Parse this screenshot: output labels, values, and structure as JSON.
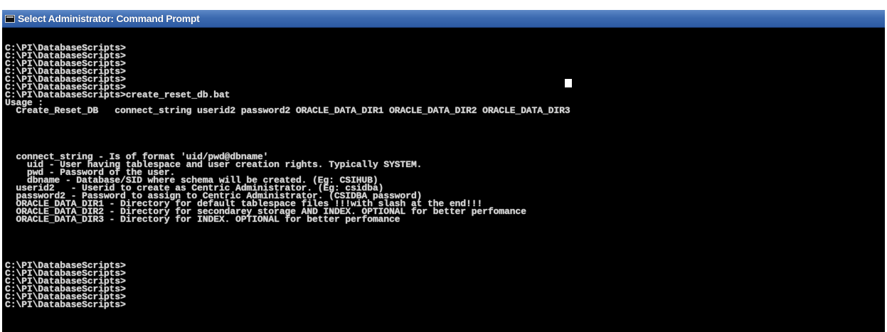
{
  "window": {
    "title": "Select Administrator: Command Prompt",
    "icon": "cmd-icon"
  },
  "console": {
    "lines_top": [
      "C:\\PI\\DatabaseScripts>",
      "C:\\PI\\DatabaseScripts>",
      "C:\\PI\\DatabaseScripts>",
      "C:\\PI\\DatabaseScripts>",
      "C:\\PI\\DatabaseScripts>",
      "C:\\PI\\DatabaseScripts>",
      "C:\\PI\\DatabaseScripts>create_reset_db.bat",
      "Usage :",
      "  Create_Reset_DB   connect_string userid2 password2 ORACLE_DATA_DIR1 ORACLE_DATA_DIR2 ORACLE_DATA_DIR3"
    ],
    "lines_usage": [
      "  connect_string - Is of format 'uid/pwd@dbname'",
      "    uid - User having tablespace and user creation rights. Typically SYSTEM.",
      "    pwd - Password of the user.",
      "    dbname - Database/SID where schema will be created. (Eg: CSIHUB)",
      "  userid2   - Userid to create as Centric Administrator. (Eg: csidba)",
      "  password2 - Password to assign to Centric Administrator. (CSIDBA password)",
      "  ORACLE_DATA_DIR1 - Directory for default tablespace files !!!with slash at the end!!!",
      "  ORACLE_DATA_DIR2 - Directory for secondarey storage AND INDEX. OPTIONAL for better perfomance",
      "  ORACLE_DATA_DIR3 - Directory for INDEX. OPTIONAL for better perfomance"
    ],
    "lines_bottom": [
      "C:\\PI\\DatabaseScripts>",
      "C:\\PI\\DatabaseScripts>",
      "C:\\PI\\DatabaseScripts>",
      "C:\\PI\\DatabaseScripts>",
      "C:\\PI\\DatabaseScripts>",
      "C:\\PI\\DatabaseScripts>"
    ]
  },
  "colors": {
    "background": "#000000",
    "text": "#d2d2d2",
    "titlebar": "#3c6ab0"
  }
}
